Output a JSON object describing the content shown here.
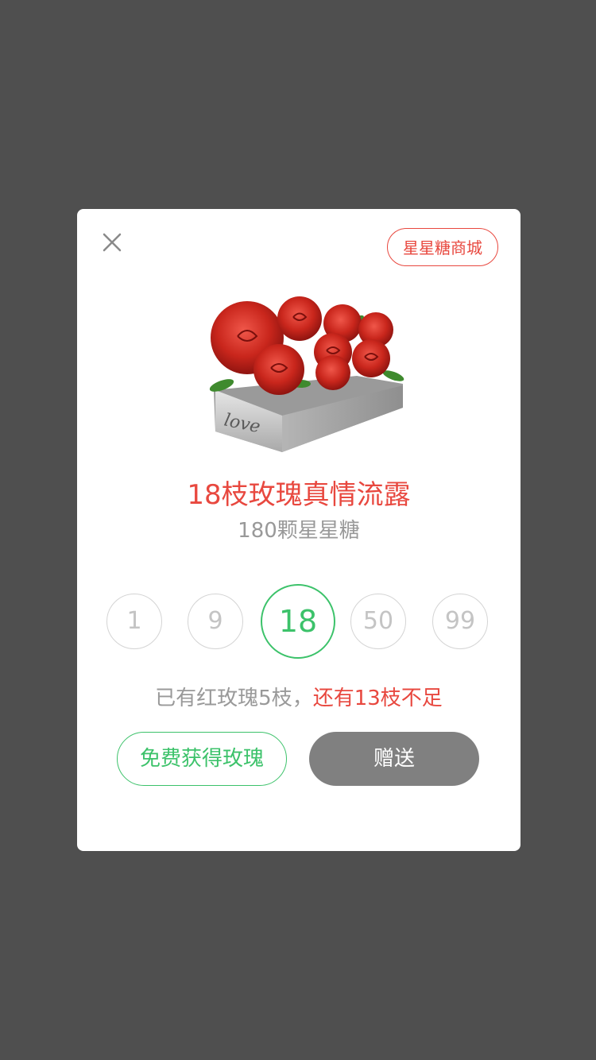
{
  "dialog": {
    "shop_button": "星星糖商城",
    "gift_image_caption": "love",
    "gift_title": "18枝玫瑰真情流露",
    "gift_price": "180颗星星糖",
    "quantities": [
      "1",
      "9",
      "18",
      "50",
      "99"
    ],
    "selected_quantity": "18",
    "status_have": "已有红玫瑰5枝，",
    "status_lack": "还有13枝不足",
    "free_button": "免费获得玫瑰",
    "send_button": "赠送"
  },
  "colors": {
    "accent_red": "#e8483f",
    "accent_green": "#3cc26a",
    "overlay": "#4f4f4f",
    "disabled_button": "#808080"
  },
  "icons": {
    "close": "close-icon"
  }
}
